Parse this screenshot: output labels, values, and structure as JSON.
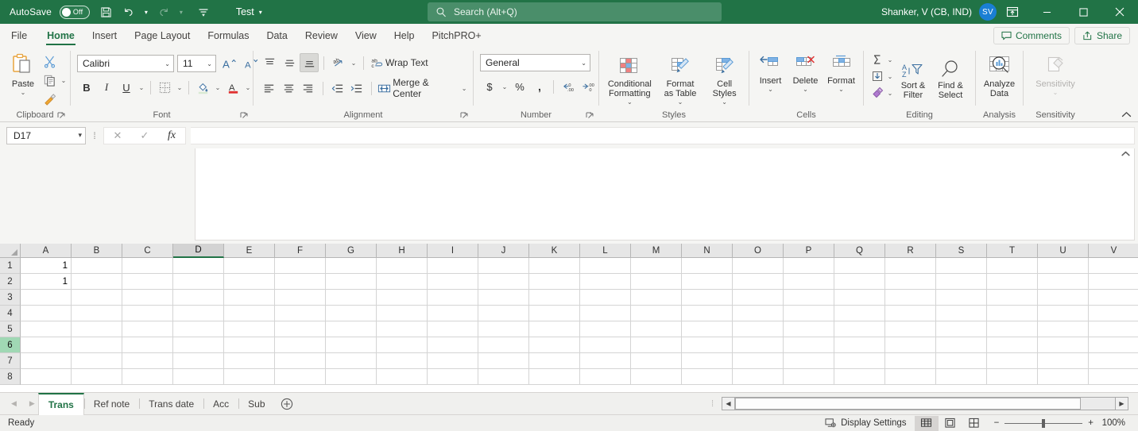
{
  "titlebar": {
    "autosave_label": "AutoSave",
    "autosave_state": "Off",
    "save_icon": "save-icon",
    "undo_icon": "undo-icon",
    "redo_icon": "redo-icon",
    "customize_qat_icon": "customize-quick-access-toolbar-icon",
    "document_title": "Test",
    "search_placeholder": "Search (Alt+Q)",
    "search_icon": "search-icon",
    "user_name": "Shanker, V (CB, IND)",
    "user_initials": "SV",
    "ribbon_display_icon": "ribbon-display-options-icon",
    "minimize_icon": "minimize-icon",
    "maximize_icon": "maximize-icon",
    "close_icon": "close-icon",
    "accent_color": "#217346",
    "avatar_color": "#1a7fd4"
  },
  "ribbon_tabs": [
    {
      "label": "File",
      "active": false
    },
    {
      "label": "Home",
      "active": true
    },
    {
      "label": "Insert",
      "active": false
    },
    {
      "label": "Page Layout",
      "active": false
    },
    {
      "label": "Formulas",
      "active": false
    },
    {
      "label": "Data",
      "active": false
    },
    {
      "label": "Review",
      "active": false
    },
    {
      "label": "View",
      "active": false
    },
    {
      "label": "Help",
      "active": false
    },
    {
      "label": "PitchPRO+",
      "active": false
    }
  ],
  "tabstrip_right": {
    "comments_label": "Comments",
    "comments_icon": "comment-icon",
    "share_label": "Share",
    "share_icon": "share-icon"
  },
  "ribbon": {
    "collapse_icon": "collapse-ribbon-icon",
    "groups": {
      "clipboard": {
        "label": "Clipboard",
        "paste_label": "Paste",
        "paste_icon": "paste-icon",
        "cut_icon": "cut-icon",
        "copy_icon": "copy-icon",
        "format_painter_icon": "format-painter-icon",
        "dialog_launcher_icon": "dialog-launcher-icon"
      },
      "font": {
        "label": "Font",
        "font_name": "Calibri",
        "font_size": "11",
        "grow_font_icon": "increase-font-size-icon",
        "shrink_font_icon": "decrease-font-size-icon",
        "bold_label": "B",
        "italic_label": "I",
        "underline_label": "U",
        "borders_icon": "borders-icon",
        "fill_color_icon": "fill-color-icon",
        "font_color_icon": "font-color-icon",
        "dialog_launcher_icon": "dialog-launcher-icon"
      },
      "alignment": {
        "label": "Alignment",
        "top_align_icon": "top-align-icon",
        "middle_align_icon": "middle-align-icon",
        "bottom_align_icon": "bottom-align-icon",
        "orientation_icon": "orientation-icon",
        "wrap_text_label": "Wrap Text",
        "wrap_text_icon": "wrap-text-icon",
        "align_left_icon": "align-left-icon",
        "align_center_icon": "align-center-icon",
        "align_right_icon": "align-right-icon",
        "decrease_indent_icon": "decrease-indent-icon",
        "increase_indent_icon": "increase-indent-icon",
        "merge_center_label": "Merge & Center",
        "merge_center_icon": "merge-and-center-icon",
        "dialog_launcher_icon": "dialog-launcher-icon"
      },
      "number": {
        "label": "Number",
        "format": "General",
        "currency_icon": "accounting-number-format-icon",
        "percent_icon": "percent-style-icon",
        "comma_icon": "comma-style-icon",
        "increase_decimal_icon": "increase-decimal-icon",
        "decrease_decimal_icon": "decrease-decimal-icon",
        "dialog_launcher_icon": "dialog-launcher-icon"
      },
      "styles": {
        "label": "Styles",
        "conditional_formatting_label": "Conditional Formatting",
        "conditional_formatting_icon": "conditional-formatting-icon",
        "format_as_table_label": "Format as Table",
        "format_as_table_icon": "format-as-table-icon",
        "cell_styles_label": "Cell Styles",
        "cell_styles_icon": "cell-styles-icon"
      },
      "cells": {
        "label": "Cells",
        "insert_label": "Insert",
        "insert_icon": "insert-cells-icon",
        "delete_label": "Delete",
        "delete_icon": "delete-cells-icon",
        "format_label": "Format",
        "format_icon": "format-cells-icon"
      },
      "editing": {
        "label": "Editing",
        "autosum_icon": "autosum-icon",
        "fill_icon": "fill-icon",
        "clear_icon": "clear-icon",
        "sort_filter_label": "Sort & Filter",
        "sort_filter_icon": "sort-and-filter-icon",
        "find_select_label": "Find & Select",
        "find_select_icon": "find-and-select-icon"
      },
      "analysis": {
        "label": "Analysis",
        "analyze_data_label": "Analyze Data",
        "analyze_data_icon": "analyze-data-icon"
      },
      "sensitivity": {
        "label": "Sensitivity",
        "sensitivity_label": "Sensitivity",
        "sensitivity_icon": "sensitivity-icon"
      }
    }
  },
  "formula_bar": {
    "name_box_value": "D17",
    "cancel_icon": "cancel-icon",
    "enter_icon": "enter-icon",
    "function_icon": "insert-function-icon",
    "formula_value": "",
    "expanded": true,
    "collapse_icon": "collapse-formula-bar-icon"
  },
  "grid": {
    "columns": [
      "A",
      "B",
      "C",
      "D",
      "E",
      "F",
      "G",
      "H",
      "I",
      "J",
      "K",
      "L",
      "M",
      "N",
      "O",
      "P",
      "Q",
      "R",
      "S",
      "T",
      "U",
      "V"
    ],
    "selected_column": "D",
    "rows": [
      "1",
      "2",
      "3",
      "4",
      "5",
      "6",
      "7",
      "8"
    ],
    "selected_row": "6",
    "cell_values": [
      {
        "ref": "A1",
        "row": 0,
        "col": 0,
        "value": "1"
      },
      {
        "ref": "A2",
        "row": 1,
        "col": 0,
        "value": "1"
      }
    ],
    "vscroll": {
      "up_icon": "scroll-up-icon",
      "down_icon": "scroll-down-icon"
    }
  },
  "sheet_bar": {
    "first_icon": "first-sheet-icon",
    "prev_icon": "previous-sheet-icon",
    "tabs": [
      {
        "label": "Trans",
        "active": true
      },
      {
        "label": "Ref note",
        "active": false
      },
      {
        "label": "Trans date",
        "active": false
      },
      {
        "label": "Acc",
        "active": false
      },
      {
        "label": "Sub",
        "active": false
      }
    ],
    "add_sheet_icon": "add-sheet-icon",
    "hscroll_left_icon": "scroll-left-icon",
    "hscroll_right_icon": "scroll-right-icon"
  },
  "status_bar": {
    "status": "Ready",
    "display_settings_label": "Display Settings",
    "display_settings_icon": "display-settings-icon",
    "normal_view_icon": "normal-view-icon",
    "page_layout_view_icon": "page-layout-view-icon",
    "page_break_view_icon": "page-break-preview-icon",
    "zoom_out_label": "−",
    "zoom_in_label": "+",
    "zoom_level": "100%"
  }
}
